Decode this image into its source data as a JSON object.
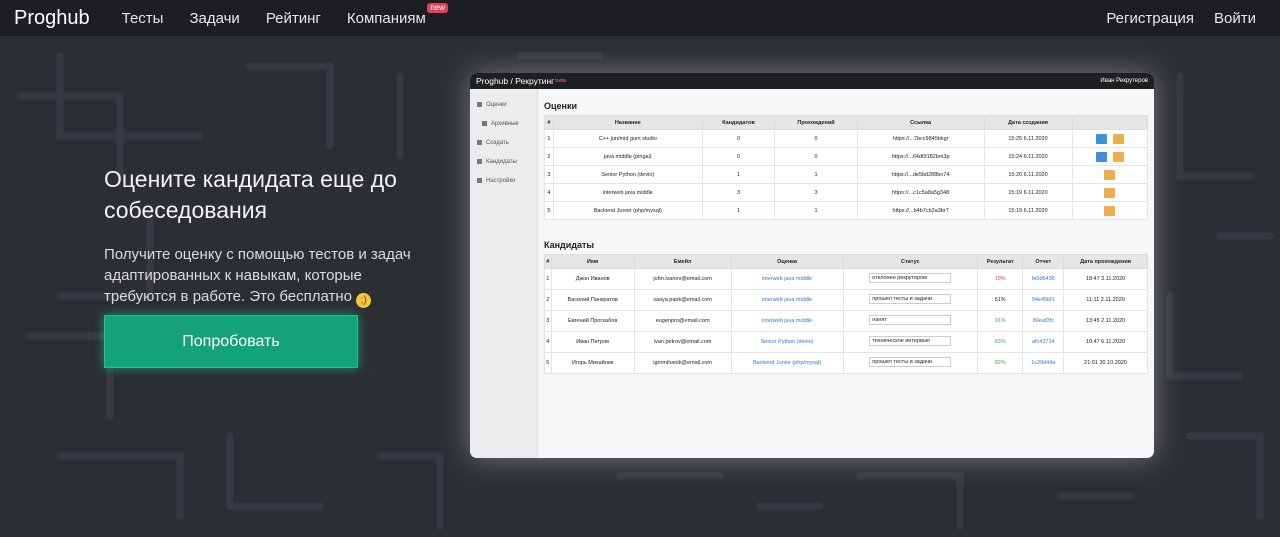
{
  "nav": {
    "brand": "Proghub",
    "items": [
      "Тесты",
      "Задачи",
      "Рейтинг",
      "Компаниям"
    ],
    "new_badge": "new",
    "register": "Регистрация",
    "login": "Войти"
  },
  "hero": {
    "title": "Оцените кандидата еще до собеседования",
    "subtitle": "Получите оценку с помощью тестов и задач адаптированных к навыкам, которые требуются в работе. Это бесплатно",
    "button": "Попробовать"
  },
  "preview": {
    "header_title": "Proghub / Рекрутинг",
    "beta": "beta",
    "user": "Иван Рекрутеров",
    "sidebar": [
      "Оценки",
      "Архивные",
      "Создать",
      "Кандидаты",
      "Настройки"
    ],
    "assessments": {
      "heading": "Оценки",
      "columns": [
        "#",
        "Название",
        "Кандидатов",
        "Прохождений",
        "Ссылка",
        "Дата создания",
        ""
      ],
      "rows": [
        [
          "1",
          "C++ jun/mid gum studio",
          "0",
          "0",
          "https://...7bcc9845bkgr",
          "15:25 6.11.2020"
        ],
        [
          "2",
          "java middle (pingai)",
          "0",
          "0",
          "https://...64d6f182bm3p",
          "15:24 6.11.2020"
        ],
        [
          "3",
          "Senior Python (devio)",
          "1",
          "1",
          "https://...de5bd288bn74",
          "15:20 6.11.2020"
        ],
        [
          "4",
          "interweb java middle",
          "3",
          "3",
          "https://...c1c5a8a5g348",
          "15:19 6.11.2020"
        ],
        [
          "5",
          "Backend Junior (php/mysql)",
          "1",
          "1",
          "https://...b4b7cb2a3br7",
          "15:19 6.11.2020"
        ]
      ]
    },
    "candidates": {
      "heading": "Кандидаты",
      "columns": [
        "#",
        "Имя",
        "Емейл",
        "Оценка",
        "Статус",
        "Результат",
        "Отчет",
        "Дата прохождения"
      ],
      "rows": [
        [
          "1",
          "Джон Иванов",
          "john.ivanov@email.com",
          "interweb java middle",
          "отклонен рекрутером",
          "19%",
          "fe0d6436",
          "18:47 3.11.2020"
        ],
        [
          "2",
          "Василий Панкратов",
          "vasya.pank@email.com",
          "interweb java middle",
          "прошел тесты и задачи",
          "51%",
          "94e45bf1",
          "11:11 2.11.2020"
        ],
        [
          "3",
          "Евгений Прогхабов",
          "eugenpro@email.com",
          "interweb java middle",
          "нанят",
          "91%",
          "80eaf2fc",
          "13:45 2.11.2020"
        ],
        [
          "4",
          "Иван Петров",
          "ivan.petrov@email.com",
          "Senior Python (devio)",
          "техническое интервью",
          "83%",
          "afc43714",
          "10:47 6.11.2020"
        ],
        [
          "5",
          "Игорь Михайлик",
          "igormihanik@email.com",
          "Backend Junior (php/mysql)",
          "прошел тесты и задачи",
          "82%",
          "1c29d44a",
          "21:01 30.10.2020"
        ]
      ]
    }
  }
}
